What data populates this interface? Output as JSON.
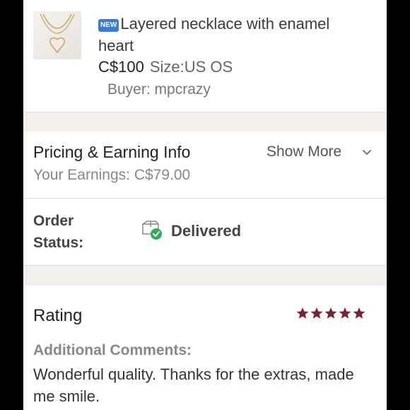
{
  "item": {
    "badge": "NEW",
    "title": "Layered necklace with enamel heart",
    "price": "C$100",
    "size": "Size:US OS",
    "buyer": "Buyer: mpcrazy",
    "thumbnail_icon": "necklace-photo"
  },
  "pricing": {
    "title": "Pricing & Earning Info",
    "show_more": "Show More",
    "earnings": "Your Earnings: C$79.00"
  },
  "order_status": {
    "label_line1": "Order",
    "label_line2": "Status:",
    "value": "Delivered",
    "icon": "box-check-icon",
    "check_color": "#34a853"
  },
  "rating": {
    "title": "Rating",
    "stars": 5,
    "max_stars": 5,
    "star_color": "#7b2336",
    "comments_label": "Additional Comments:",
    "comments": "Wonderful quality. Thanks for the extras, made me smile."
  }
}
